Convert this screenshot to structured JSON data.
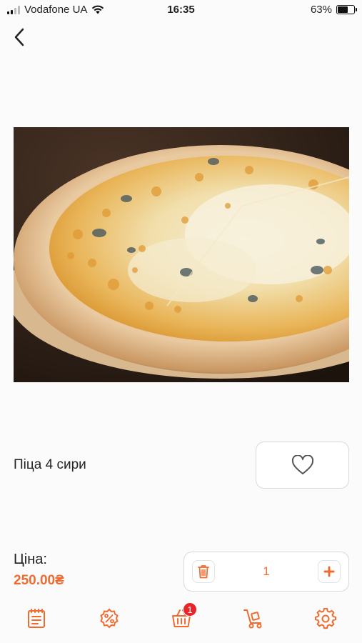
{
  "status_bar": {
    "carrier": "Vodafone UA",
    "time": "16:35",
    "battery": "63%",
    "battery_level": 0.63
  },
  "product": {
    "name": "Піца 4 сири",
    "price_label": "Ціна:",
    "price": "250.00₴",
    "quantity": "1"
  },
  "tab_bar": {
    "items": [
      {
        "icon": "menu-list-icon"
      },
      {
        "icon": "discount-percent-icon"
      },
      {
        "icon": "cart-icon",
        "badge": "1"
      },
      {
        "icon": "delivery-cart-icon"
      },
      {
        "icon": "settings-gear-icon"
      }
    ]
  },
  "colors": {
    "accent": "#f26a2e",
    "badge": "#e8262a",
    "border": "#d9d9d9"
  }
}
